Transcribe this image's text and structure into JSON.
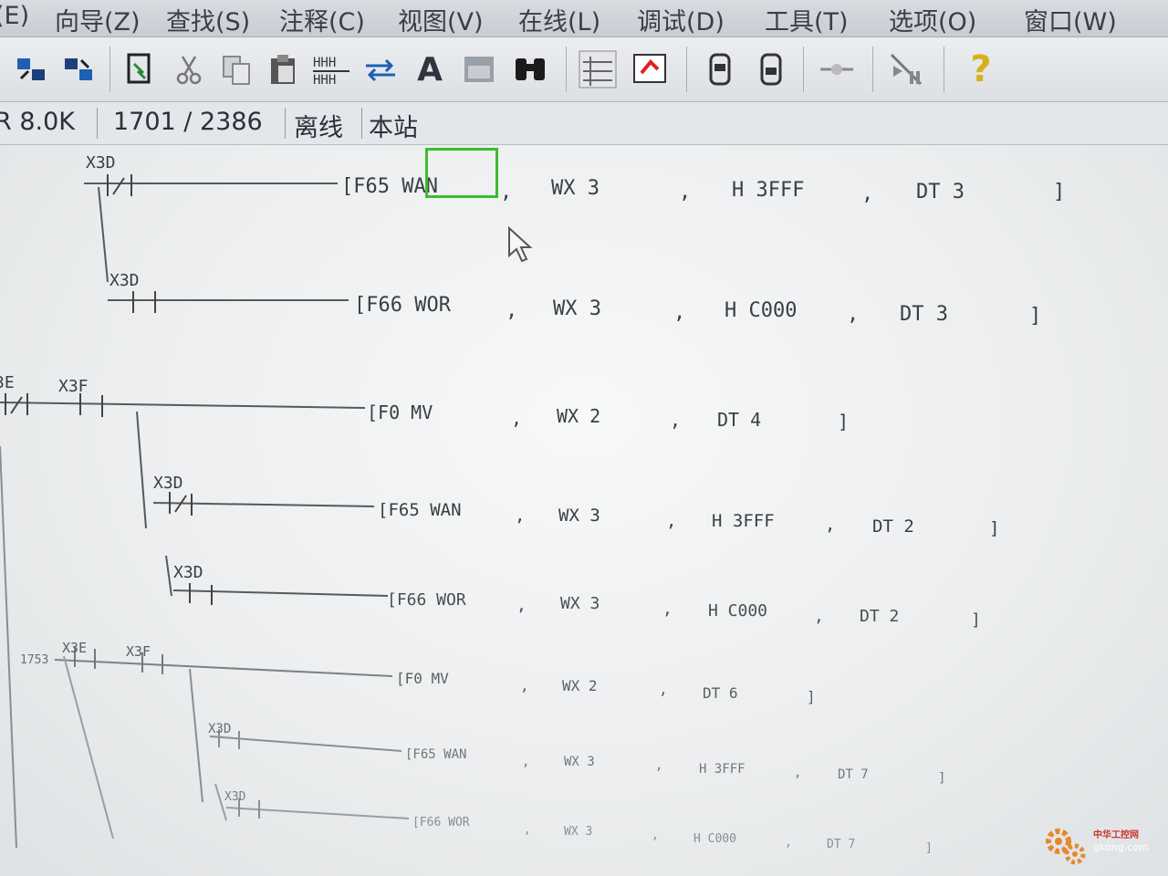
{
  "menu": {
    "items": [
      "(E)",
      "向导(Z)",
      "查找(S)",
      "注释(C)",
      "视图(V)",
      "在线(L)",
      "调试(D)",
      "工具(T)",
      "选项(O)",
      "窗口(W)"
    ]
  },
  "toolbar": {
    "buttons": [
      {
        "icon": "transfer-up-icon"
      },
      {
        "icon": "transfer-down-icon"
      },
      {
        "icon": "monitor-edit-icon"
      },
      {
        "icon": "cut-icon"
      },
      {
        "icon": "copy-icon"
      },
      {
        "icon": "paste-icon"
      },
      {
        "icon": "insert-row-icon"
      },
      {
        "icon": "convert-icon"
      },
      {
        "icon": "font-icon",
        "label": "A"
      },
      {
        "icon": "window-icon"
      },
      {
        "icon": "find-binoculars-icon"
      },
      {
        "icon": "grid-view-icon"
      },
      {
        "icon": "display-toggle-icon"
      },
      {
        "icon": "plc-read-icon"
      },
      {
        "icon": "plc-write-icon"
      },
      {
        "icon": "monitor-icon"
      },
      {
        "icon": "step-run-icon"
      },
      {
        "icon": "help-icon",
        "label": "?"
      }
    ]
  },
  "status": {
    "memory": "R 8.0K",
    "steps": "1701 /  2386",
    "mode": "离线",
    "station": "本站"
  },
  "ladder": {
    "rungs": [
      {
        "contact": "X3D",
        "operands": [
          "[F65 WAN",
          ",",
          "WX 3",
          ",",
          "H 3FFF",
          ",",
          "DT 3",
          "]"
        ]
      },
      {
        "contact": "X3D",
        "operands": [
          "[F66 WOR",
          ",",
          "WX 3",
          ",",
          "H C000",
          ",",
          "DT 3",
          "]"
        ]
      },
      {
        "contacts": [
          "3E",
          "X3F"
        ],
        "operands": [
          "[F0 MV",
          ",",
          "WX 2",
          ",",
          "DT 4",
          "]"
        ]
      },
      {
        "contact": "X3D",
        "operands": [
          "[F65 WAN",
          ",",
          "WX 3",
          ",",
          "H 3FFF",
          ",",
          "DT 2",
          "]"
        ]
      },
      {
        "contact": "X3D",
        "operands": [
          "[F66 WOR",
          ",",
          "WX 3",
          ",",
          "H C000",
          ",",
          "DT 2",
          "]"
        ]
      },
      {
        "address": "1753",
        "contacts": [
          "X3E",
          "X3F"
        ],
        "operands": [
          "[F0 MV",
          ",",
          "WX 2",
          ",",
          "DT 6",
          "]"
        ]
      },
      {
        "contact": "X3D",
        "operands": [
          "[F65 WAN",
          ",",
          "WX 3",
          ",",
          "H 3FFF",
          ",",
          "DT 7",
          "]"
        ]
      },
      {
        "contact": "X3D",
        "operands": [
          "[F66 WOR",
          ",",
          "WX 3",
          ",",
          "H C000",
          ",",
          "DT 7",
          "]"
        ]
      }
    ]
  },
  "watermark": {
    "brand": "中华工控网",
    "url": "gkong.com"
  },
  "colors": {
    "cursor": "#3dbb2e",
    "ladder_line": "#555a60",
    "watermark": "#e5892b"
  }
}
